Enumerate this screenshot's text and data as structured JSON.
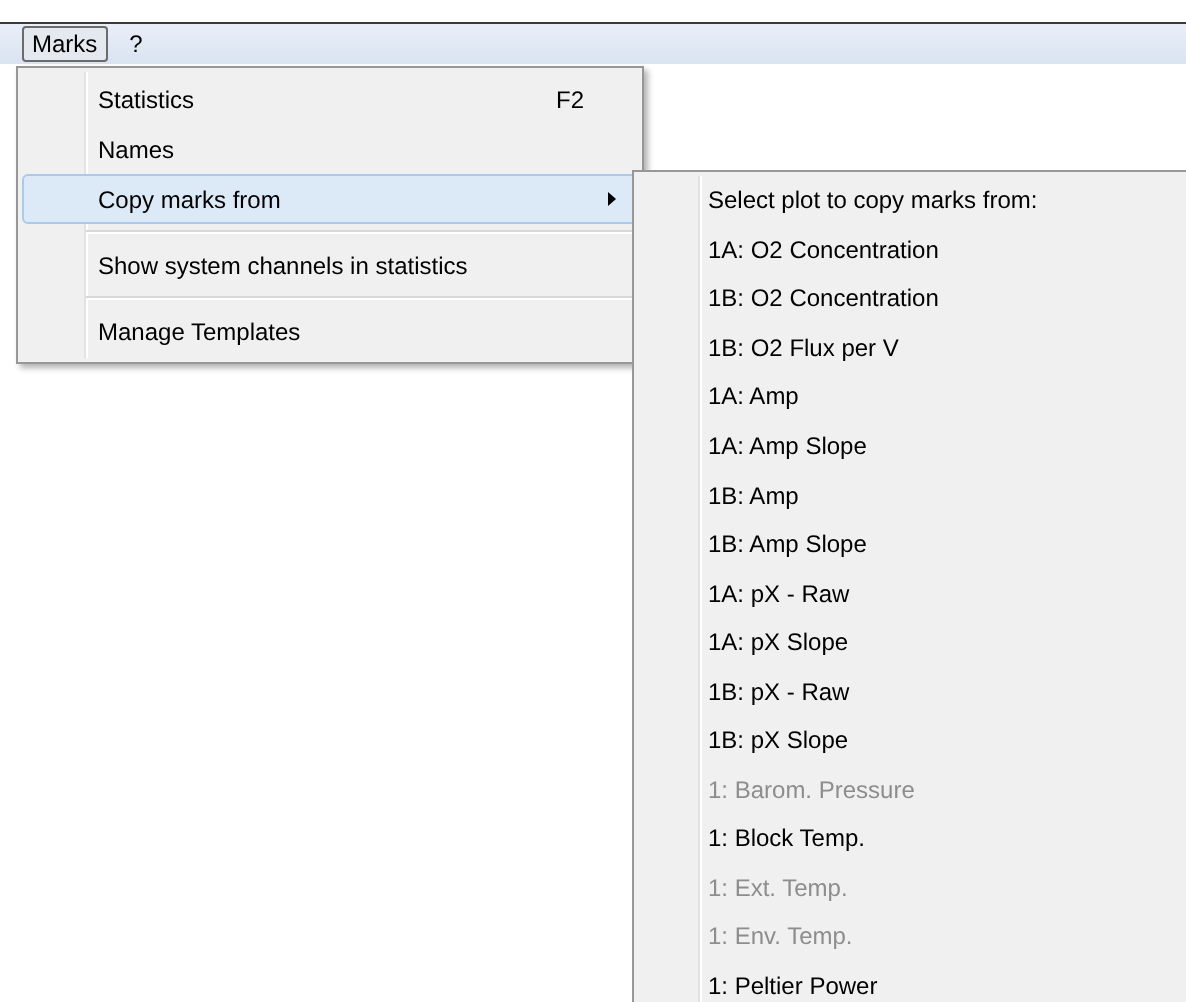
{
  "menubar": [
    {
      "label": "Marks",
      "selected": true
    },
    {
      "label": "?",
      "selected": false
    }
  ],
  "menu": [
    {
      "kind": "item",
      "label": "Statistics",
      "shortcut": "F2",
      "selected": false,
      "has_submenu": false
    },
    {
      "kind": "item",
      "label": "Names",
      "selected": false,
      "has_submenu": false
    },
    {
      "kind": "item",
      "label": "Copy marks from",
      "selected": true,
      "has_submenu": true
    },
    {
      "kind": "separator"
    },
    {
      "kind": "item",
      "label": "Show system channels in statistics",
      "selected": false,
      "has_submenu": false
    },
    {
      "kind": "separator"
    },
    {
      "kind": "item",
      "label": "Manage Templates",
      "selected": false,
      "has_submenu": false
    }
  ],
  "submenu": [
    {
      "kind": "header",
      "label": "Select plot to copy marks from:"
    },
    {
      "kind": "item",
      "label": "1A: O2 Concentration",
      "disabled": false
    },
    {
      "kind": "item",
      "label": "1B: O2 Concentration",
      "disabled": false
    },
    {
      "kind": "item",
      "label": "1B: O2 Flux per V",
      "disabled": false
    },
    {
      "kind": "item",
      "label": "1A: Amp",
      "disabled": false
    },
    {
      "kind": "item",
      "label": "1A: Amp Slope",
      "disabled": false
    },
    {
      "kind": "item",
      "label": "1B: Amp",
      "disabled": false
    },
    {
      "kind": "item",
      "label": "1B: Amp Slope",
      "disabled": false
    },
    {
      "kind": "item",
      "label": "1A: pX - Raw",
      "disabled": false
    },
    {
      "kind": "item",
      "label": "1A: pX Slope",
      "disabled": false
    },
    {
      "kind": "item",
      "label": "1B: pX - Raw",
      "disabled": false
    },
    {
      "kind": "item",
      "label": "1B: pX Slope",
      "disabled": false
    },
    {
      "kind": "item",
      "label": "1: Barom. Pressure",
      "disabled": true
    },
    {
      "kind": "item",
      "label": "1: Block Temp.",
      "disabled": false
    },
    {
      "kind": "item",
      "label": "1: Ext. Temp.",
      "disabled": true
    },
    {
      "kind": "item",
      "label": "1: Env. Temp.",
      "disabled": true
    },
    {
      "kind": "item",
      "label": "1: Peltier Power",
      "disabled": false
    }
  ]
}
